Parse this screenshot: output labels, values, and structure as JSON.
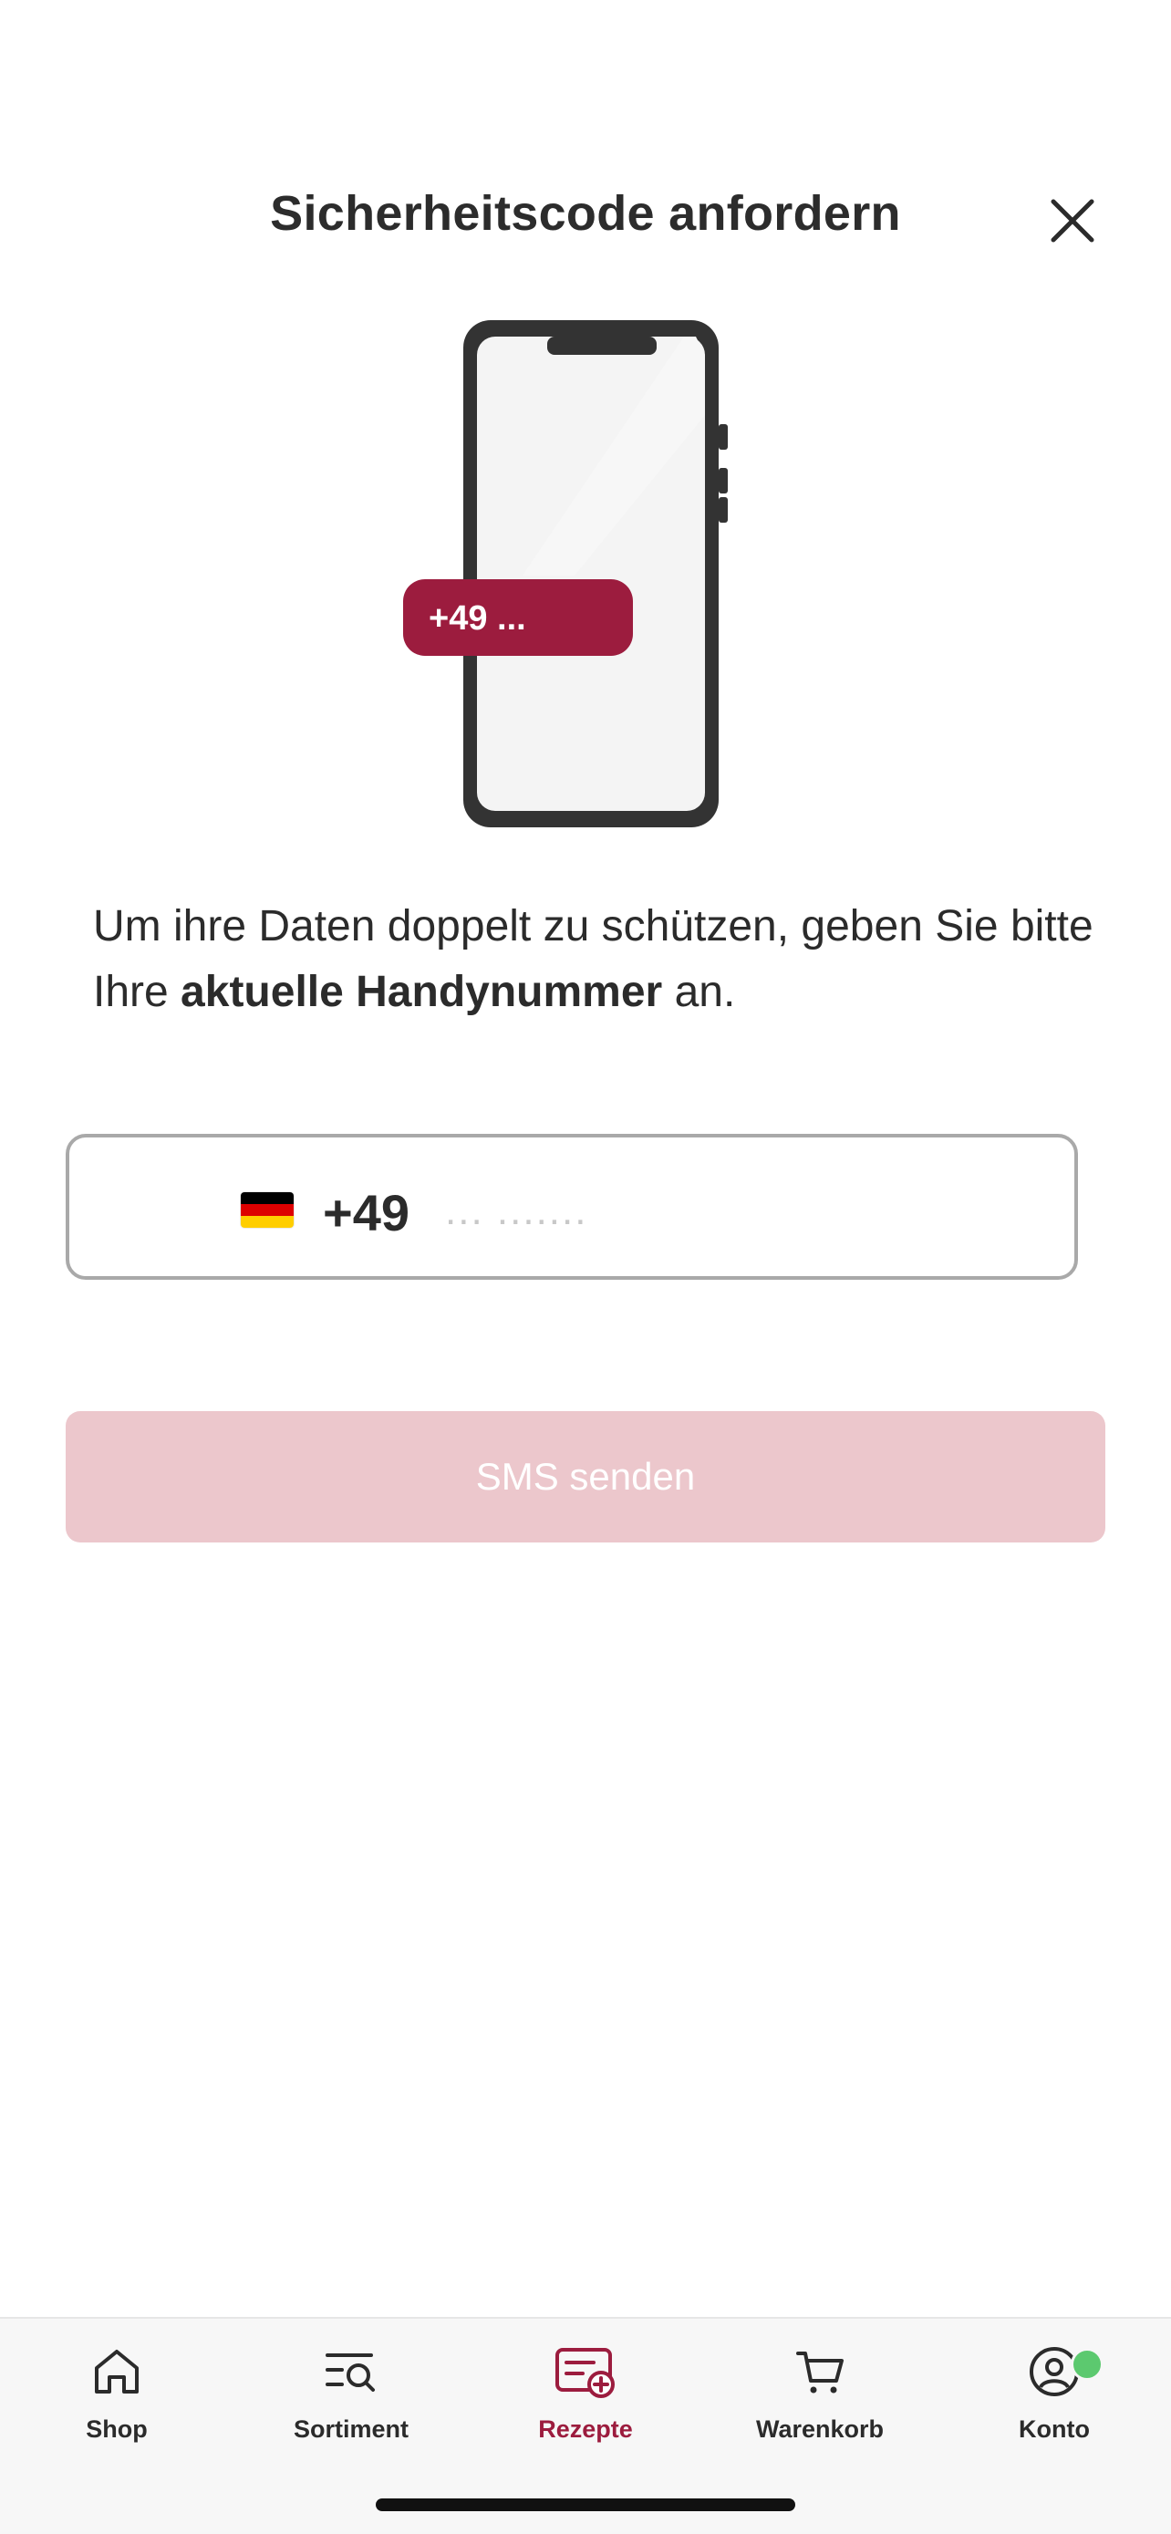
{
  "header": {
    "title": "Sicherheitscode anfordern",
    "close_icon": "close-icon"
  },
  "illustration": {
    "bubble_text": "+49 ...",
    "accent_color": "#9c1c3e"
  },
  "intro": {
    "text_before": "Um ihre Daten doppelt zu schützen, geben Sie bitte Ihre ",
    "text_bold": "aktuelle Handynummer",
    "text_after": " an."
  },
  "phone": {
    "flag_icon": "germany-flag-icon",
    "prefix": "+49",
    "value": "",
    "placeholder": "... ......."
  },
  "sms_button": {
    "label": "SMS senden",
    "color": "#ecc7cc",
    "enabled": false
  },
  "tabs": [
    {
      "label": "Shop",
      "icon": "home-icon",
      "active": false
    },
    {
      "label": "Sortiment",
      "icon": "search-list-icon",
      "active": false
    },
    {
      "label": "Rezepte",
      "icon": "prescription-add-icon",
      "active": true
    },
    {
      "label": "Warenkorb",
      "icon": "cart-icon",
      "active": false
    },
    {
      "label": "Konto",
      "icon": "account-icon",
      "active": false,
      "badge_color": "#5cc96f"
    }
  ]
}
